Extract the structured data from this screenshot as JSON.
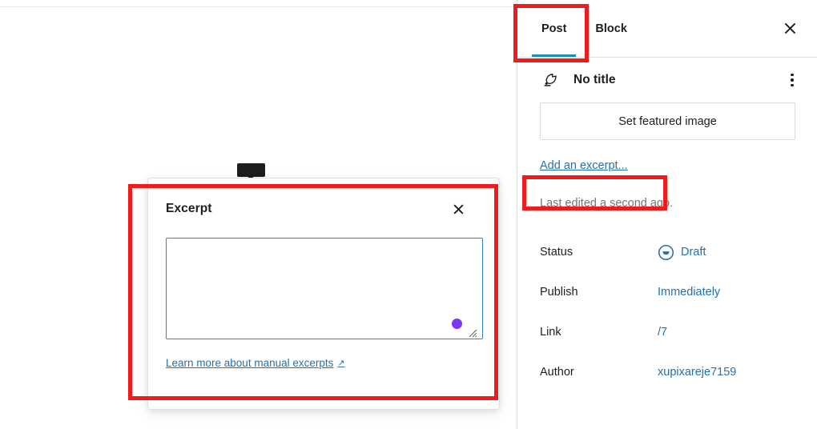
{
  "editor": {
    "block_toolbar_tooltip": ""
  },
  "excerpt_popover": {
    "title": "Excerpt",
    "close_label": "Close",
    "textarea_value": "",
    "textarea_placeholder": "",
    "learn_more_label": "Learn more about manual excerpts",
    "external_link_glyph": "↗"
  },
  "sidebar": {
    "tabs": [
      {
        "label": "Post",
        "active": true
      },
      {
        "label": "Block",
        "active": false
      }
    ],
    "close_label": "Close Settings",
    "post_summary": {
      "post_type_icon": "quill-pen-icon",
      "title": "No title",
      "actions_icon": "kebab-menu-icon",
      "featured_image_label": "Set featured image",
      "add_excerpt_label": "Add an excerpt...",
      "last_edited": "Last edited a second ago."
    },
    "meta": [
      {
        "label": "Status",
        "value": "Draft",
        "icon": "draft-status-icon"
      },
      {
        "label": "Publish",
        "value": "Immediately",
        "icon": ""
      },
      {
        "label": "Link",
        "value": "/7",
        "icon": ""
      },
      {
        "label": "Author",
        "value": "xupixareje7159",
        "icon": ""
      }
    ]
  },
  "annotations": {
    "accent_color": "#ee1c1c",
    "highlighted": [
      "post-tab",
      "add-an-excerpt-link",
      "excerpt-popover"
    ]
  },
  "colors": {
    "link": "#2271b1",
    "tab_underline": "#1e8cbe",
    "textarea_border": "#3582c4",
    "caret_dot": "#7f36f0",
    "muted_text": "#757575",
    "border": "#e0e0e0"
  }
}
